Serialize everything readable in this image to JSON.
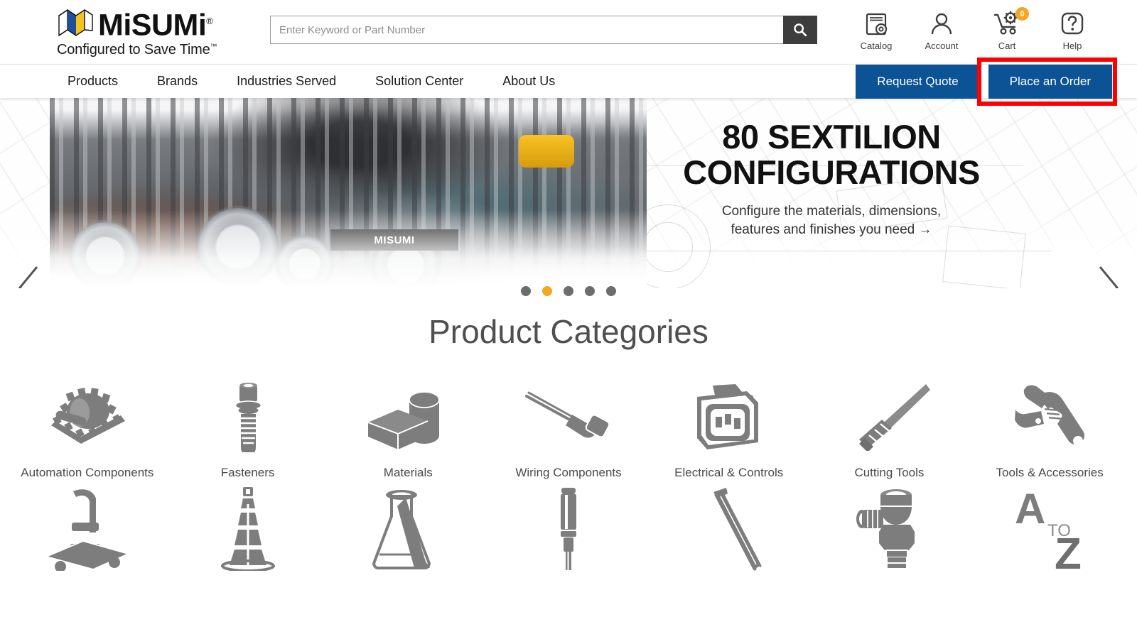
{
  "brand": {
    "name": "MiSUMi",
    "registered": "®",
    "tagline": "Configured to Save Time",
    "tagline_tm": "™"
  },
  "search": {
    "placeholder": "Enter Keyword or Part Number",
    "value": "",
    "button_icon": "search-icon"
  },
  "header_icons": [
    {
      "icon": "catalog-icon",
      "label": "Catalog"
    },
    {
      "icon": "account-icon",
      "label": "Account"
    },
    {
      "icon": "cart-icon",
      "label": "Cart",
      "badge": "0"
    },
    {
      "icon": "help-icon",
      "label": "Help"
    }
  ],
  "nav": {
    "items": [
      {
        "label": "Products"
      },
      {
        "label": "Brands"
      },
      {
        "label": "Industries Served"
      },
      {
        "label": "Solution Center"
      },
      {
        "label": "About Us"
      }
    ],
    "cta": [
      {
        "label": "Request Quote",
        "highlighted": false
      },
      {
        "label": "Place an Order",
        "highlighted": true
      }
    ],
    "cta_color": "#0b5394",
    "highlight_color": "#ff0000"
  },
  "hero": {
    "title_line1": "80 SEXTILION",
    "title_line2": "CONFIGURATIONS",
    "subtitle_line1": "Configure the materials, dimensions,",
    "subtitle_line2": "features and finishes you need →",
    "plate_label": "MISUMI",
    "prev_icon": "chevron-left-icon",
    "next_icon": "chevron-right-icon",
    "slides": 5,
    "active_slide": 2,
    "active_dot_color": "#f5a623",
    "dot_color": "#6d6d6d"
  },
  "categories": {
    "heading": "Product Categories",
    "items": [
      {
        "label": "Automation Components",
        "icon": "gear-shaft-icon"
      },
      {
        "label": "Fasteners",
        "icon": "screw-icon"
      },
      {
        "label": "Materials",
        "icon": "block-cylinder-icon"
      },
      {
        "label": "Wiring Components",
        "icon": "connector-cable-icon"
      },
      {
        "label": "Electrical & Controls",
        "icon": "power-socket-icon"
      },
      {
        "label": "Cutting Tools",
        "icon": "drill-bit-icon"
      },
      {
        "label": "Tools & Accessories",
        "icon": "wrench-icon"
      },
      {
        "label": "",
        "icon": "platform-cart-icon"
      },
      {
        "label": "",
        "icon": "traffic-cone-icon"
      },
      {
        "label": "",
        "icon": "flask-icon"
      },
      {
        "label": "",
        "icon": "screwdriver-icon"
      },
      {
        "label": "",
        "icon": "chisel-icon"
      },
      {
        "label": "",
        "icon": "pneumatic-fitting-icon"
      },
      {
        "label": "",
        "icon": "a-to-z-icon"
      }
    ]
  }
}
